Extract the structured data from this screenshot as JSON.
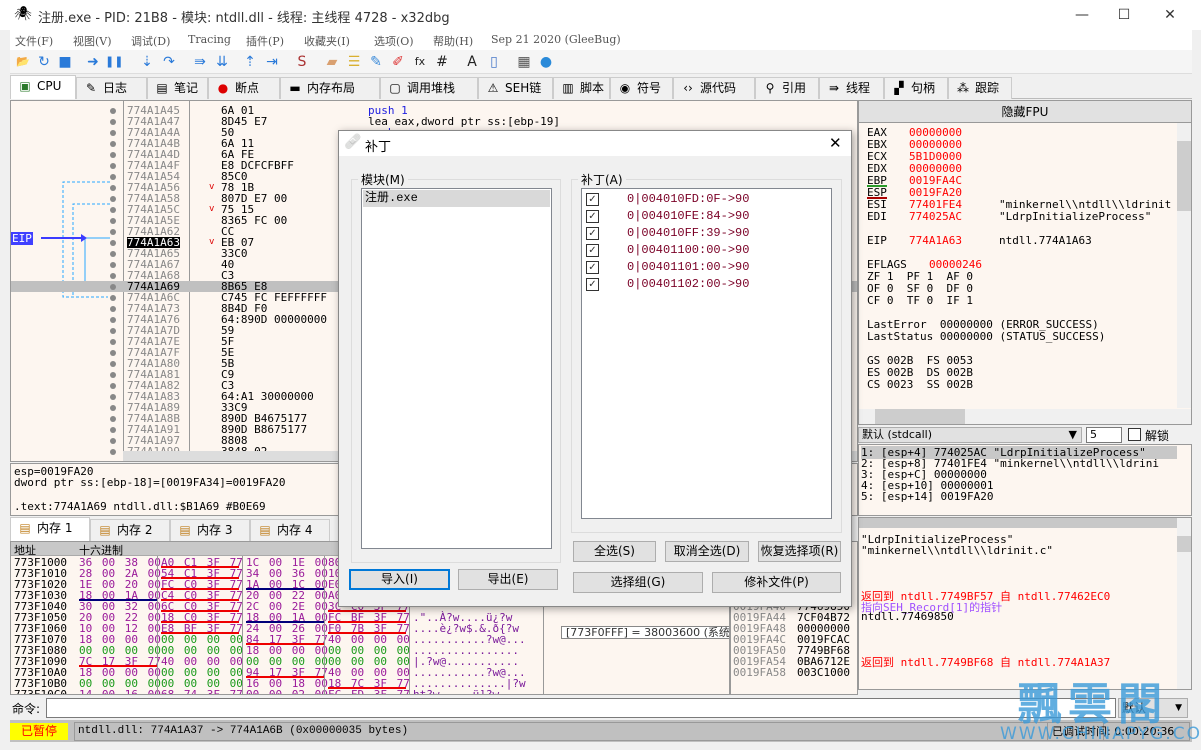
{
  "window": {
    "title": "注册.exe - PID: 21B8 - 模块: ntdll.dll - 线程: 主线程 4728 - x32dbg",
    "minimize": "—",
    "maximize": "☐",
    "close": "✕"
  },
  "menu": [
    "文件(F)",
    "视图(V)",
    "调试(D)",
    "Tracing",
    "插件(P)",
    "收藏夹(I)",
    "选项(O)",
    "帮助(H)",
    "Sep 21 2020 (GleeBug)"
  ],
  "toolbar": [
    "open-icon",
    "restart-icon",
    "stop-icon",
    "run-icon",
    "pause-icon",
    "step-into-icon",
    "step-over-icon",
    "trace-into-icon",
    "trace-over-icon",
    "execute-till-return-icon",
    "run-to-user-code-icon",
    "scylla-icon",
    "patch-icon",
    "comment-icon",
    "label-icon",
    "bookmark-icon",
    "function-icon",
    "hash-icon",
    "font-icon",
    "device-icon",
    "calculator-icon",
    "globe-icon"
  ],
  "tabs": [
    {
      "label": "CPU",
      "icon": "cpu-icon",
      "active": true
    },
    {
      "label": "日志",
      "icon": "log-icon"
    },
    {
      "label": "笔记",
      "icon": "notes-icon"
    },
    {
      "label": "断点",
      "icon": "breakpoint-icon"
    },
    {
      "label": "内存布局",
      "icon": "memory-map-icon"
    },
    {
      "label": "调用堆栈",
      "icon": "call-stack-icon"
    },
    {
      "label": "SEH链",
      "icon": "seh-icon"
    },
    {
      "label": "脚本",
      "icon": "script-icon"
    },
    {
      "label": "符号",
      "icon": "symbol-icon"
    },
    {
      "label": "源代码",
      "icon": "source-icon"
    },
    {
      "label": "引用",
      "icon": "references-icon"
    },
    {
      "label": "线程",
      "icon": "threads-icon"
    },
    {
      "label": "句柄",
      "icon": "handles-icon"
    },
    {
      "label": "跟踪",
      "icon": "trace-icon"
    }
  ],
  "disasm": {
    "eip_label": "EIP",
    "eip_address": "774A1A63",
    "selected_address": "774A1A69",
    "rows": [
      {
        "addr": "774A1A45",
        "bytes": "6A 01",
        "instr": "push 1"
      },
      {
        "addr": "774A1A47",
        "bytes": "8D45 E7",
        "instr": "lea eax,dword ptr ss:[ebp-19]"
      },
      {
        "addr": "774A1A4A",
        "bytes": "50",
        "instr": "push eax"
      },
      {
        "addr": "774A1A4B",
        "bytes": "6A 11"
      },
      {
        "addr": "774A1A4D",
        "bytes": "6A FE"
      },
      {
        "addr": "774A1A4F",
        "bytes": "E8 DCFCFBFF"
      },
      {
        "addr": "774A1A54",
        "bytes": "85C0"
      },
      {
        "addr": "774A1A56",
        "bytes": "78 1B",
        "jump": true
      },
      {
        "addr": "774A1A58",
        "bytes": "807D E7 00"
      },
      {
        "addr": "774A1A5C",
        "bytes": "75 15",
        "jump": true
      },
      {
        "addr": "774A1A5E",
        "bytes": "8365 FC 00"
      },
      {
        "addr": "774A1A62",
        "bytes": "CC"
      },
      {
        "addr": "774A1A63",
        "bytes": "EB 07",
        "jump": true
      },
      {
        "addr": "774A1A65",
        "bytes": "33C0"
      },
      {
        "addr": "774A1A67",
        "bytes": "40"
      },
      {
        "addr": "774A1A68",
        "bytes": "C3"
      },
      {
        "addr": "774A1A69",
        "bytes": "8B65 E8"
      },
      {
        "addr": "774A1A6C",
        "bytes": "C745 FC FEFFFFFF"
      },
      {
        "addr": "774A1A73",
        "bytes": "8B4D F0"
      },
      {
        "addr": "774A1A76",
        "bytes": "64:890D 00000000"
      },
      {
        "addr": "774A1A7D",
        "bytes": "59"
      },
      {
        "addr": "774A1A7E",
        "bytes": "5F"
      },
      {
        "addr": "774A1A7F",
        "bytes": "5E"
      },
      {
        "addr": "774A1A80",
        "bytes": "5B"
      },
      {
        "addr": "774A1A81",
        "bytes": "C9"
      },
      {
        "addr": "774A1A82",
        "bytes": "C3"
      },
      {
        "addr": "774A1A83",
        "bytes": "64:A1 30000000"
      },
      {
        "addr": "774A1A89",
        "bytes": "33C9"
      },
      {
        "addr": "774A1A8B",
        "bytes": "890D B4675177"
      },
      {
        "addr": "774A1A91",
        "bytes": "890D B8675177"
      },
      {
        "addr": "774A1A97",
        "bytes": "8808"
      },
      {
        "addr": "774A1A99",
        "bytes": "3848 02"
      }
    ]
  },
  "registers": {
    "fpu_button": "隐藏FPU",
    "lines": [
      {
        "name": "EAX",
        "value": "00000000"
      },
      {
        "name": "EBX",
        "value": "00000000"
      },
      {
        "name": "ECX",
        "value": "5B1D0000"
      },
      {
        "name": "EDX",
        "value": "00000000"
      },
      {
        "name": "EBP",
        "value": "0019FA4C"
      },
      {
        "name": "ESP",
        "value": "0019FA20"
      },
      {
        "name": "ESI",
        "value": "77401FE4",
        "comment": "\"minkernel\\\\ntdll\\\\ldrinit"
      },
      {
        "name": "EDI",
        "value": "774025AC",
        "comment": "\"LdrpInitializeProcess\""
      },
      {
        "name": "",
        "value": ""
      },
      {
        "name": "EIP",
        "value": "774A1A63",
        "comment": "ntdll.774A1A63"
      },
      {
        "name": "",
        "value": ""
      },
      {
        "name": "EFLAGS",
        "value": "00000246"
      }
    ],
    "flags": [
      "ZF 1  PF 1  AF 0",
      "OF 0  SF 0  DF 0",
      "CF 0  TF 0  IF 1"
    ],
    "last_error": "LastError  00000000 (ERROR_SUCCESS)",
    "last_status": "LastStatus 00000000 (STATUS_SUCCESS)",
    "segments": [
      "GS 002B  FS 0053",
      "ES 002B  DS 002B",
      "CS 0023  SS 002B"
    ]
  },
  "callconv": {
    "selected": "默认 (stdcall)",
    "arg_count": "5",
    "unlock_label": "解锁",
    "unlocked": false
  },
  "args": [
    "1: [esp+4] 774025AC \"LdrpInitializeProcess\"",
    "2: [esp+8] 77401FE4 \"minkernel\\\\ntdll\\\\ldrini",
    "3: [esp+C] 00000000",
    "4: [esp+10] 00000001",
    "5: [esp+14] 0019FA20"
  ],
  "stack_comments": [
    {
      "text": "",
      "color": "#000"
    },
    {
      "text": "\"LdrpInitializeProcess\"",
      "color": "#000"
    },
    {
      "text": "\"minkernel\\\\ntdll\\\\ldrinit.c\"",
      "color": "#000"
    },
    {
      "text": "",
      "color": "#000"
    },
    {
      "text": "",
      "color": "#000"
    },
    {
      "text": "",
      "color": "#000"
    },
    {
      "text": "返回到 ntdll.7749BF57 自 ntdll.77462EC0",
      "color": "#ff0000"
    },
    {
      "text": "指向SEH_Record[1]的指针",
      "color": "#a050ff"
    },
    {
      "text": "ntdll.77469850",
      "color": "#000"
    },
    {
      "text": "",
      "color": "#000"
    },
    {
      "text": "",
      "color": "#000"
    },
    {
      "text": "",
      "color": "#000"
    },
    {
      "text": "返回到 ntdll.7749BF68 自 ntdll.774A1A37",
      "color": "#ff0000"
    }
  ],
  "info": [
    "esp=0019FA20",
    "dword ptr ss:[ebp-18]=[0019FA34]=0019FA20",
    "",
    ".text:774A1A69 ntdll.dll:$B1A69 #B0E69"
  ],
  "memtabs": [
    "内存 1",
    "内存 2",
    "内存 3",
    "内存 4"
  ],
  "hexdump": {
    "headers": [
      "地址",
      "十六进制"
    ],
    "rows": [
      {
        "addr": "773F1000",
        "g": [
          "36 00 38 00",
          "A0 C1 3F 77",
          "1C 00 1E 00",
          "80"
        ],
        "ul": [
          "",
          "red",
          "",
          ""
        ],
        "ascii": ""
      },
      {
        "addr": "773F1010",
        "g": [
          "28 00 2A 00",
          "54 C1 3F 77",
          "34 00 36 00",
          "10"
        ],
        "ul": [
          "",
          "red",
          "",
          ""
        ],
        "ascii": ""
      },
      {
        "addr": "773F1020",
        "g": [
          "1E 00 20 00",
          "FC C0 3F 77",
          "1A 00 1C 00",
          "E0"
        ],
        "ul": [
          "",
          "red",
          "blue",
          ""
        ],
        "ascii": ""
      },
      {
        "addr": "773F1030",
        "g": [
          "18 00 1A 00",
          "C4 C0 3F 77",
          "20 00 22 00",
          "A0"
        ],
        "ul": [
          "blue",
          "red",
          "",
          ""
        ],
        "ascii": ""
      },
      {
        "addr": "773F1040",
        "g": [
          "30 00 32 00",
          "6C C0 3F 77",
          "2C 00 2E 00",
          "3C C0 3F 77"
        ],
        "ul": [
          "",
          "red",
          "",
          "red"
        ],
        "ascii": ""
      },
      {
        "addr": "773F1050",
        "g": [
          "20 00 22 00",
          "18 C0 3F 77",
          "18 00 1A 00",
          "FC BF 3F 77"
        ],
        "ul": [
          "",
          "red",
          "blue",
          "red"
        ],
        "ascii": ".\"..À?w....ü¿?w"
      },
      {
        "addr": "773F1060",
        "g": [
          "10 00 12 00",
          "E8 BF 3F 77",
          "24 00 26 00",
          "F0 7B 3F 77"
        ],
        "ul": [
          "",
          "red",
          "",
          "red"
        ],
        "ascii": "....è¿?w$.&.ð{?w"
      },
      {
        "addr": "773F1070",
        "g": [
          "18 00 00 00",
          "00 00 00 00",
          "84 17 3F 77",
          "40 00 00 00"
        ],
        "ul": [
          "",
          "",
          "red",
          ""
        ],
        "ascii": "...........?w@..."
      },
      {
        "addr": "773F1080",
        "g": [
          "00 00 00 00",
          "00 00 00 00",
          "18 00 00 00",
          "00 00 00 00"
        ],
        "ul": [
          "",
          "",
          "",
          ""
        ],
        "ascii": "................"
      },
      {
        "addr": "773F1090",
        "g": [
          "7C 17 3F 77",
          "40 00 00 00",
          "00 00 00 00",
          "00 00 00 00"
        ],
        "ul": [
          "red",
          "",
          "",
          ""
        ],
        "ascii": "|.?w@..........."
      },
      {
        "addr": "773F10A0",
        "g": [
          "18 00 00 00",
          "00 00 00 00",
          "94 17 3F 77",
          "40 00 00 00"
        ],
        "ul": [
          "",
          "",
          "red",
          ""
        ],
        "ascii": "...........?w@..."
      },
      {
        "addr": "773F10B0",
        "g": [
          "00 00 00 00",
          "00 00 00 00",
          "16 00 18 00",
          "18 7C 3F 77"
        ],
        "ul": [
          "",
          "",
          "",
          "red"
        ],
        "ascii": "..............|?w"
      },
      {
        "addr": "773F10C0",
        "g": [
          "14 00 16 00",
          "68 74 3F 77",
          "00 00 02 00",
          "FC FD 3F 77"
        ],
        "ul": [
          "",
          "",
          "",
          ""
        ],
        "ascii": "ht?w.....ü]?w"
      }
    ],
    "tooltip": "[773F0FFF] = 38003600 (系统数据)"
  },
  "stack": [
    {
      "addr": "0019FA40",
      "value": "77469850"
    },
    {
      "addr": "0019FA44",
      "value": "7CF04B72"
    },
    {
      "addr": "0019FA48",
      "value": "00000000"
    },
    {
      "addr": "0019FA4C",
      "value": "0019FCAC"
    },
    {
      "addr": "0019FA50",
      "value": "7749BF68"
    },
    {
      "addr": "0019FA54",
      "value": "0BA6712E"
    },
    {
      "addr": "0019FA58",
      "value": "003C1000"
    }
  ],
  "command": {
    "label": "命令:",
    "value": "",
    "mode": "默认"
  },
  "status": {
    "state": "已暂停",
    "message": "ntdll.dll: 774A1A37 -> 774A1A6B (0x00000035 bytes)",
    "debug_time": "已调试时间: 0:00:20:36"
  },
  "dialog": {
    "title": "补丁",
    "close": "✕",
    "modules_label": "模块(M)",
    "modules": [
      "注册.exe"
    ],
    "patches_label": "补丁(A)",
    "patches": [
      {
        "text": "0|004010FD:0F->90",
        "checked": true
      },
      {
        "text": "0|004010FE:84->90",
        "checked": true
      },
      {
        "text": "0|004010FF:39->90",
        "checked": true
      },
      {
        "text": "0|00401100:00->90",
        "checked": true
      },
      {
        "text": "0|00401101:00->90",
        "checked": true
      },
      {
        "text": "0|00401102:00->90",
        "checked": true
      }
    ],
    "buttons": {
      "select_all": "全选(S)",
      "deselect_all": "取消全选(D)",
      "restore": "恢复选择项(R)",
      "import": "导入(I)",
      "export": "导出(E)",
      "select_group": "选择组(G)",
      "patch_file": "修补文件(P)"
    }
  },
  "watermark": {
    "main": "飄雲閣",
    "url": "WWW.CHINAPYG.COM"
  }
}
